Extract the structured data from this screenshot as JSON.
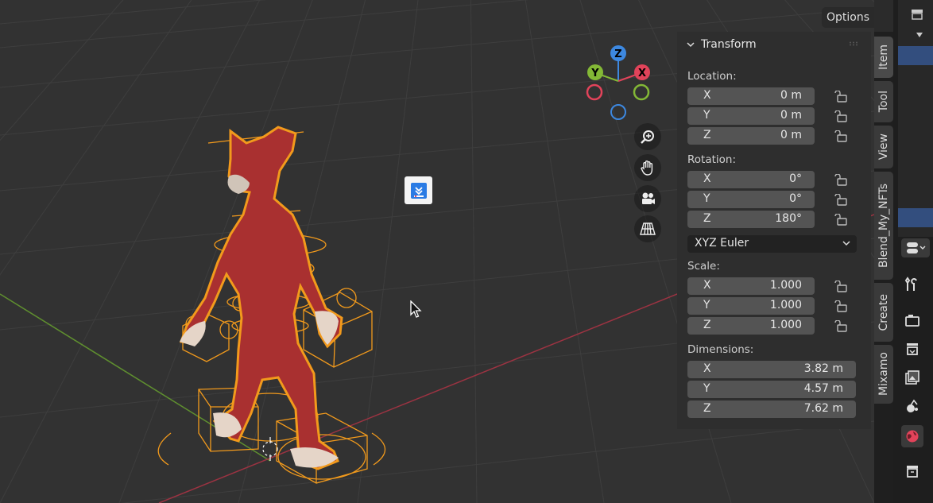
{
  "header": {
    "options_label": "Options"
  },
  "gizmo": {
    "z": "Z",
    "y": "Y",
    "x": "X"
  },
  "transform": {
    "title": "Transform",
    "location_label": "Location:",
    "location": [
      {
        "axis": "X",
        "value": "0 m"
      },
      {
        "axis": "Y",
        "value": "0 m"
      },
      {
        "axis": "Z",
        "value": "0 m"
      }
    ],
    "rotation_label": "Rotation:",
    "rotation": [
      {
        "axis": "X",
        "value": "0°"
      },
      {
        "axis": "Y",
        "value": "0°"
      },
      {
        "axis": "Z",
        "value": "180°"
      }
    ],
    "rotation_mode": "XYZ Euler",
    "scale_label": "Scale:",
    "scale": [
      {
        "axis": "X",
        "value": "1.000"
      },
      {
        "axis": "Y",
        "value": "1.000"
      },
      {
        "axis": "Z",
        "value": "1.000"
      }
    ],
    "dimensions_label": "Dimensions:",
    "dimensions": [
      {
        "axis": "X",
        "value": "3.82 m"
      },
      {
        "axis": "Y",
        "value": "4.57 m"
      },
      {
        "axis": "Z",
        "value": "7.62 m"
      }
    ]
  },
  "sidebar_tabs": [
    "Item",
    "Tool",
    "View",
    "Blend_My_NFTs",
    "Create",
    "Mixamo"
  ],
  "colors": {
    "axis_x": "#e2435a",
    "axis_y": "#83b836",
    "axis_z": "#3d88e0",
    "selection": "#f29a1c",
    "model": "#b3322f"
  },
  "icons": [
    "zoom-icon",
    "hand-pan-icon",
    "camera-icon",
    "grid-perspective-icon",
    "wrench-icon",
    "render-icon",
    "output-icon",
    "image-icon",
    "scene-icon",
    "world-icon",
    "collection-icon"
  ]
}
